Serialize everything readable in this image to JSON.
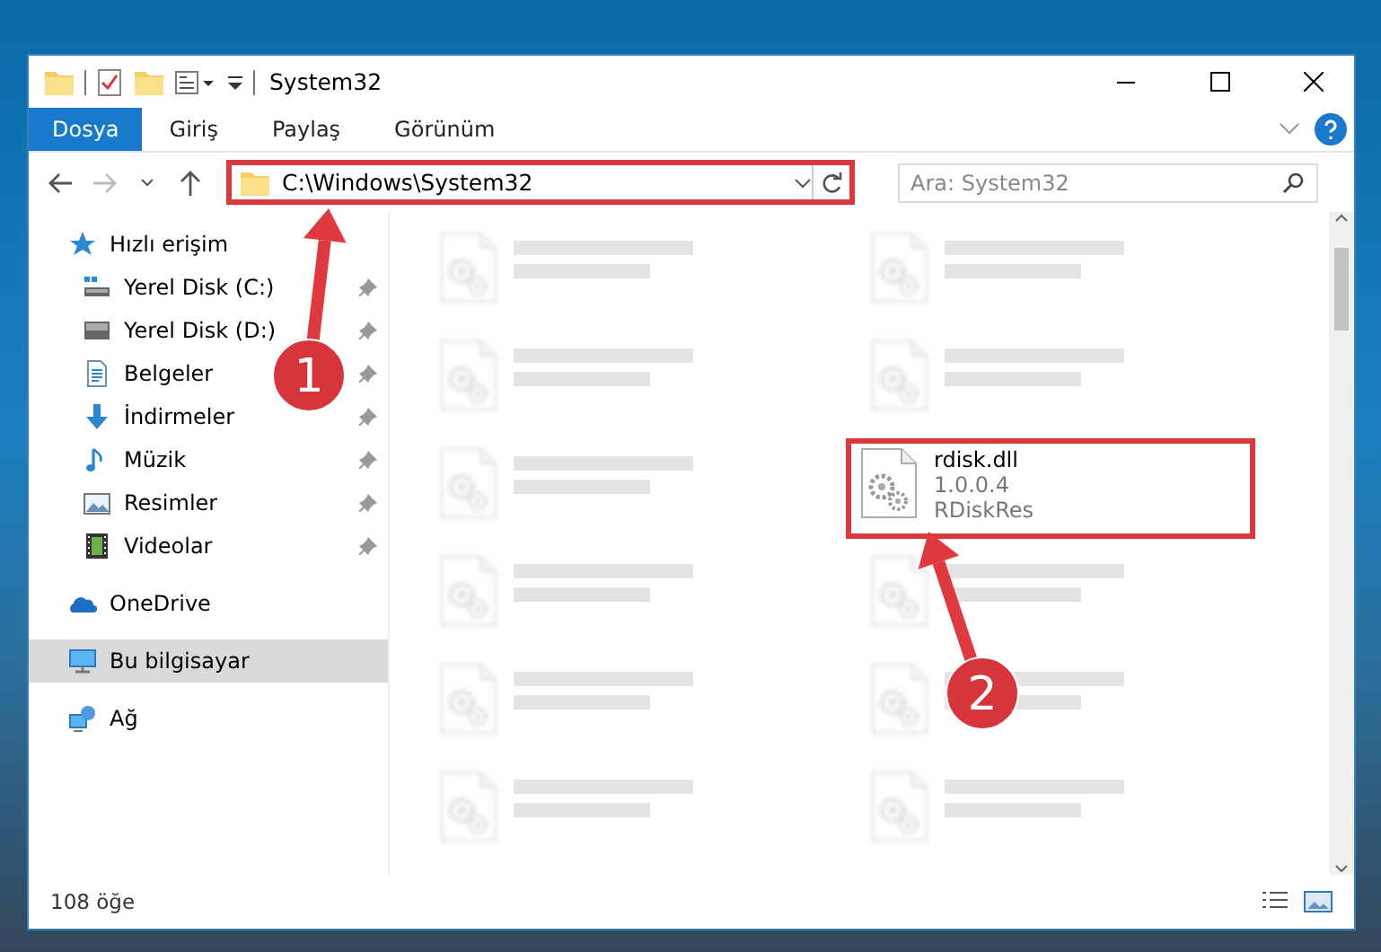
{
  "window": {
    "title": "System32"
  },
  "ribbon_tabs": [
    {
      "label": "Dosya",
      "selected": true
    },
    {
      "label": "Giriş",
      "selected": false
    },
    {
      "label": "Paylaş",
      "selected": false
    },
    {
      "label": "Görünüm",
      "selected": false
    }
  ],
  "address_bar": {
    "path": "C:\\Windows\\System32",
    "annotated": true
  },
  "search": {
    "placeholder": "Ara: System32"
  },
  "navigation": [
    {
      "label": "Hızlı erişim",
      "kind": "star",
      "selected": false,
      "children": [
        {
          "label": "Yerel Disk (C:)",
          "kind": "systemdrive",
          "pinned": true
        },
        {
          "label": "Yerel Disk (D:)",
          "kind": "drive",
          "pinned": true
        },
        {
          "label": "Belgeler",
          "kind": "document",
          "pinned": true
        },
        {
          "label": "İndirmeler",
          "kind": "download",
          "pinned": true
        },
        {
          "label": "Müzik",
          "kind": "music",
          "pinned": true
        },
        {
          "label": "Resimler",
          "kind": "picture",
          "pinned": true
        },
        {
          "label": "Videolar",
          "kind": "video",
          "pinned": true
        }
      ]
    },
    {
      "label": "OneDrive",
      "kind": "cloud",
      "selected": false
    },
    {
      "label": "Bu bilgisayar",
      "kind": "computer",
      "selected": true
    },
    {
      "label": "Ağ",
      "kind": "network",
      "selected": false
    }
  ],
  "files": [
    {
      "blurred": true
    },
    {
      "blurred": true
    },
    {
      "blurred": true
    },
    {
      "blurred": true
    },
    {
      "blurred": true
    },
    {
      "name": "rdisk.dll",
      "lines": [
        "1.0.0.4",
        "RDiskRes"
      ],
      "blurred": false,
      "annotated": true
    },
    {
      "blurred": true
    },
    {
      "blurred": true
    },
    {
      "blurred": true
    },
    {
      "blurred": true
    },
    {
      "blurred": true
    },
    {
      "blurred": true
    }
  ],
  "status_bar": {
    "item_count": "108 öğe"
  },
  "annotations": [
    {
      "label": "1"
    },
    {
      "label": "2"
    }
  ]
}
